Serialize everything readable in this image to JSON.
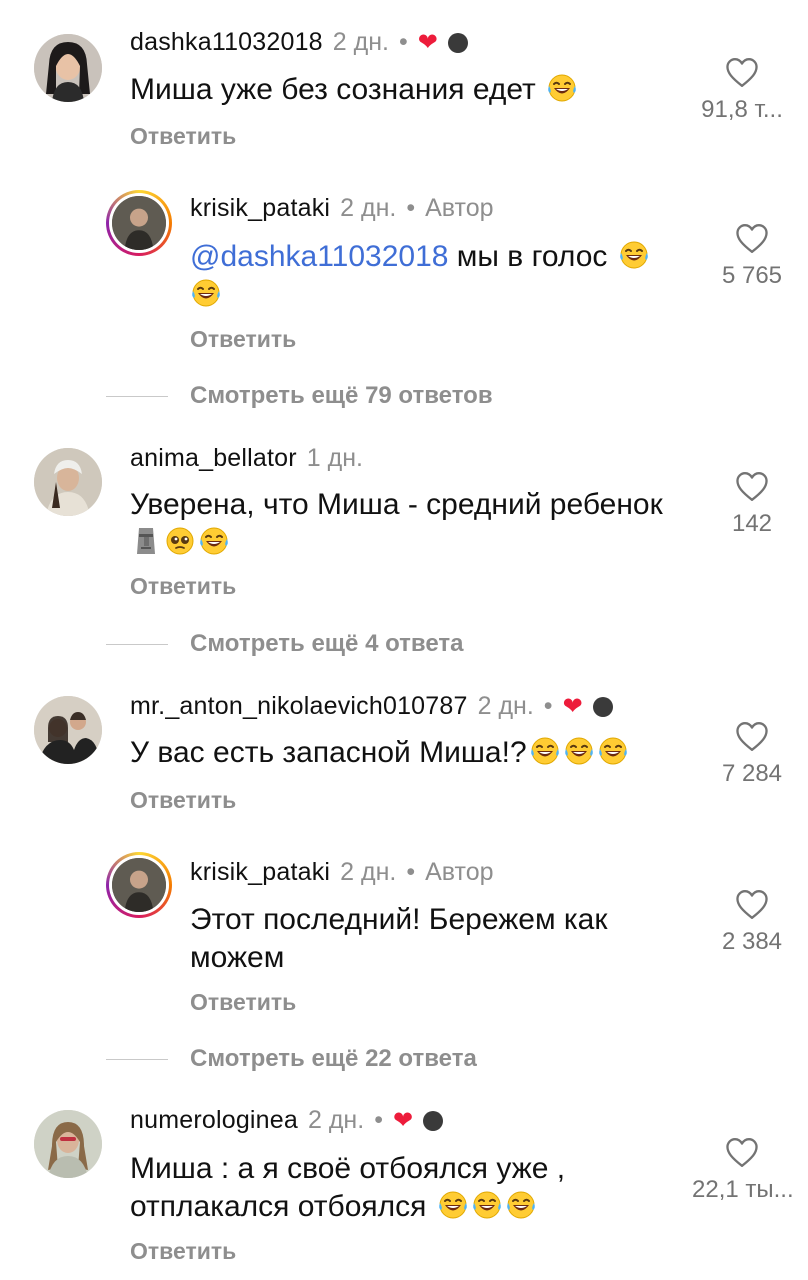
{
  "comments": [
    {
      "username": "dashka11032018",
      "time": "2 дн.",
      "dot": "•",
      "text": "Миша уже без сознания едет",
      "reply": "Ответить",
      "likes": "91,8 т..."
    },
    {
      "username": "krisik_pataki",
      "time": "2 дн.",
      "dot": "•",
      "author": "Автор",
      "mention": "@dashka11032018",
      "text": " мы в голос",
      "reply": "Ответить",
      "likes": "5 765"
    },
    {
      "username": "anima_bellator",
      "time": "1 дн.",
      "text": "Уверена, что Миша - средний ребенок",
      "reply": "Ответить",
      "likes": "142"
    },
    {
      "username": "mr._anton_nikolaevich010787",
      "time": "2 дн.",
      "dot": "•",
      "text": "У вас есть запасной Миша!?",
      "reply": "Ответить",
      "likes": "7 284"
    },
    {
      "username": "krisik_pataki",
      "time": "2 дн.",
      "dot": "•",
      "author": "Автор",
      "text_line1": "Этот последний! Бережем как",
      "text_line2": "можем",
      "reply": "Ответить",
      "likes": "2 384"
    },
    {
      "username": "numerologinea",
      "time": "2 дн.",
      "dot": "•",
      "text_line1": "Миша : а я своё отбоялся уже ,",
      "text_line2": "отплакался отбоялся",
      "reply": "Ответить",
      "likes": "22,1 ты..."
    }
  ],
  "view_more": [
    "Смотреть ещё 79 ответов",
    "Смотреть ещё 4 ответа",
    "Смотреть ещё 22 ответа"
  ],
  "icons": {
    "like": "heart-outline-icon",
    "creator_liked": "heart-filled-icon",
    "laugh": "face-with-tears-of-joy-emoji",
    "moai": "moai-emoji",
    "pleading": "pleading-face-emoji"
  },
  "colors": {
    "mention": "#3f6ed6",
    "heart": "#ed1c3b",
    "secondary_text": "#8e8e8e"
  }
}
